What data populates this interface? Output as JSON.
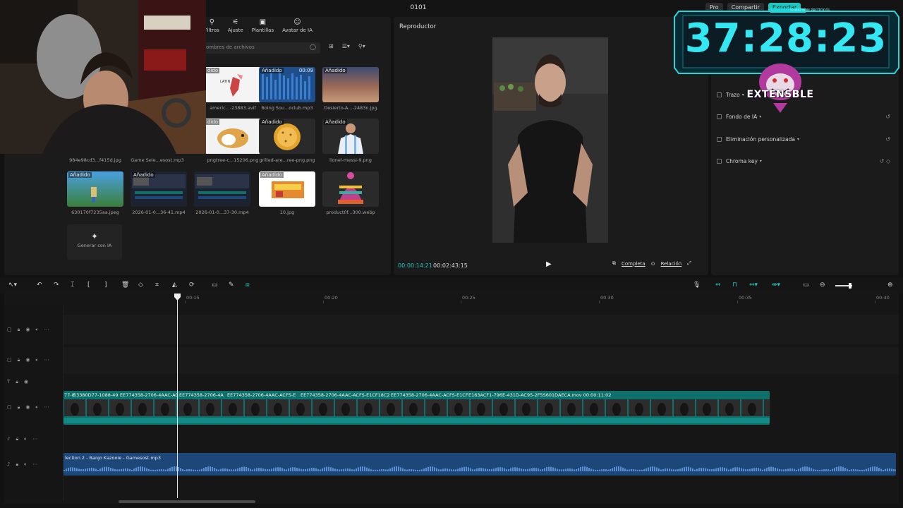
{
  "window": {
    "title": "0101",
    "buttons": [
      "Pro",
      "Compartir",
      "Exportar"
    ]
  },
  "media": {
    "tabs": [
      {
        "icon": "filters-icon",
        "label": "Filtros"
      },
      {
        "icon": "adjust-icon",
        "label": "Ajuste"
      },
      {
        "icon": "templates-icon",
        "label": "Plantillas"
      },
      {
        "icon": "ai-avatar-icon",
        "label": "Avatar de IA"
      }
    ],
    "search_placeholder": "ombres de archivos",
    "items": [
      {
        "badge": "",
        "caption": "americ...-23883.avif",
        "duration": ""
      },
      {
        "badge": "Añadido",
        "caption": "Boing Sou...oclub.mp3",
        "duration": "00:09"
      },
      {
        "badge": "Añadido",
        "caption": "Desierto-A...-2483n.jpg",
        "duration": ""
      },
      {
        "badge": "",
        "caption": "984e98cd3...f415d.jpg",
        "duration": ""
      },
      {
        "badge": "",
        "caption": "Game Sele...esost.mp3",
        "duration": ""
      },
      {
        "badge": "",
        "caption": "pngtree-c...15206.png",
        "duration": ""
      },
      {
        "badge": "Añadido",
        "caption": "grilled-are...ree-png.png",
        "duration": ""
      },
      {
        "badge": "Añadido",
        "caption": "lionel-messi-9.png",
        "duration": ""
      },
      {
        "badge": "Añadido",
        "caption": "630170f7235aa.jpeg",
        "duration": ""
      },
      {
        "badge": "Añadido",
        "caption": "2026-01-0...36-41.mp4",
        "duration": ""
      },
      {
        "badge": "",
        "caption": "2026-01-0...37-30.mp4",
        "duration": ""
      },
      {
        "badge": "Añadido",
        "caption": "10.jpg",
        "duration": ""
      },
      {
        "badge": "",
        "caption": "product0f...300.webp",
        "duration": ""
      }
    ],
    "generate_label": "Generar con IA",
    "tile_labels": {
      "dido1": "dido",
      "dido2": "dido"
    }
  },
  "player": {
    "title": "Reproductor",
    "current_time": "00:00:14:21",
    "total_time": "00:02:43:15",
    "full_label": "Completa",
    "ratio_label": "Relación"
  },
  "properties": {
    "rows": [
      {
        "label": "Trazo",
        "reset": false
      },
      {
        "label": "Fondo de IA",
        "reset": true
      },
      {
        "label": "Eliminación personalizada",
        "reset": true
      },
      {
        "label": "Chroma key",
        "reset": true
      }
    ]
  },
  "overlay": {
    "timer": "37:28:23",
    "protocol_label": "SUBATHON PROTOCOL",
    "logo_text": "EXTENSBLE",
    "colors": {
      "timer": "#33e8f2",
      "accent": "#1ec7c1",
      "video_track": "#0f6f6a",
      "audio_track": "#1d4679"
    }
  },
  "timeline": {
    "ruler": [
      "00:15",
      "00:20",
      "00:25",
      "00:30",
      "00:35",
      "00:40"
    ],
    "video_clips": [
      {
        "label": "77-8"
      },
      {
        "label": "53380D77-1088-49"
      },
      {
        "label": "EE774358-2706-4AAC-AC"
      },
      {
        "label": "EE774358-2706-4A"
      },
      {
        "label": "EE774358-2706-4AAC-ACFS-E"
      },
      {
        "label": "EE774358-2706-4AAC-ACFS-E1CF18C2"
      },
      {
        "label": "EE774358-2706-4AAC-ACFS-E1CF"
      },
      {
        "label": "E163ACF1-796E-431D-AC95-2F5S601DAECA.mov  00:00:11:02"
      }
    ],
    "audio_label": "lection 2 - Banjo Kazooie - Gamesost.mp3"
  }
}
